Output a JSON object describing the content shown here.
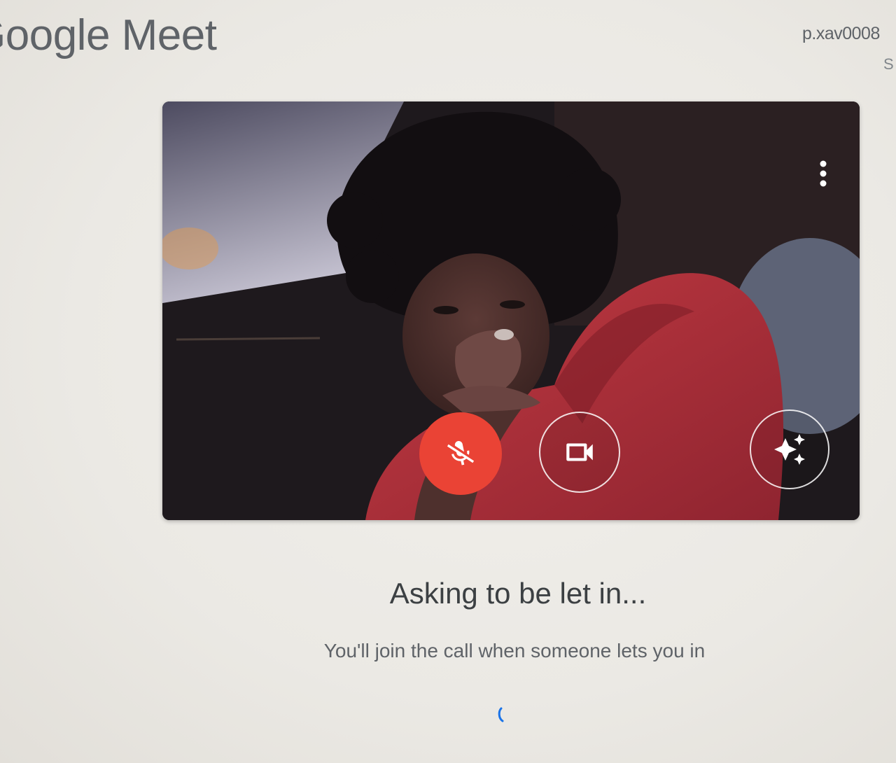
{
  "header": {
    "logo_text": "Google Meet",
    "account_email": "p.xav0008",
    "account_secondary": "S"
  },
  "preview": {
    "more_options_icon": "more-vert-icon",
    "mic_button": {
      "icon": "mic-off-icon",
      "muted": true,
      "color": "#ea4335"
    },
    "camera_button": {
      "icon": "videocam-icon",
      "camera_on": true
    },
    "effects_button": {
      "icon": "sparkle-icon"
    }
  },
  "status": {
    "title": "Asking to be let in...",
    "subtitle": "You'll join the call when someone lets you in",
    "spinner_icon": "loading-spinner-icon",
    "spinner_color": "#1a73e8"
  },
  "colors": {
    "background": "#ebe9e4",
    "text_primary": "#3c4043",
    "text_secondary": "#5f6368",
    "video_background": "#1c191c"
  }
}
